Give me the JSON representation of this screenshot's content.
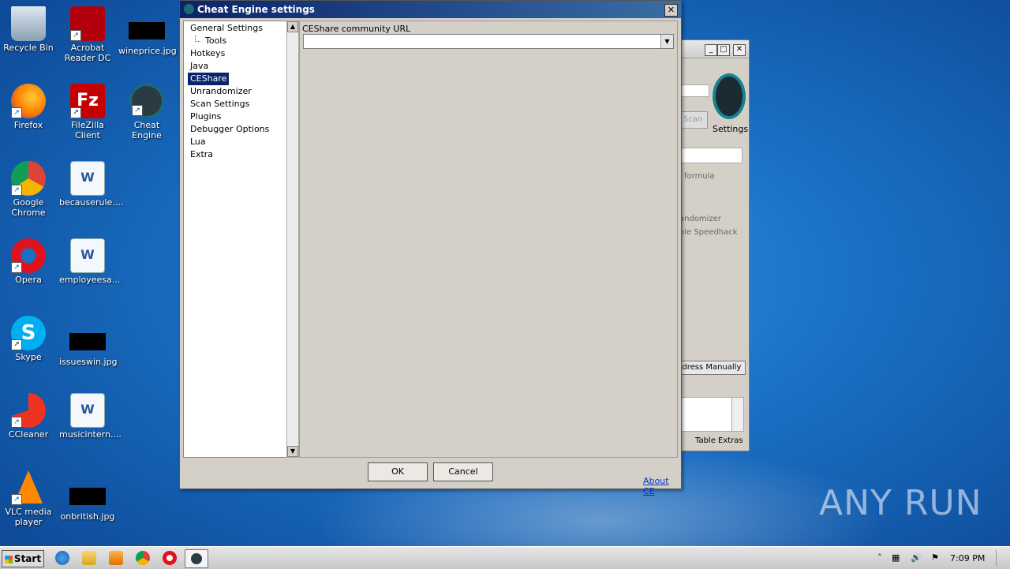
{
  "desktop": {
    "icons": [
      {
        "label": "Recycle Bin"
      },
      {
        "label": "Acrobat Reader DC"
      },
      {
        "label": "wineprice.jpg"
      },
      {
        "label": "Firefox"
      },
      {
        "label": "FileZilla Client"
      },
      {
        "label": "Cheat Engine"
      },
      {
        "label": "Google Chrome"
      },
      {
        "label": "becauserule...."
      },
      {
        "label": "Opera"
      },
      {
        "label": "employeesa..."
      },
      {
        "label": "Skype"
      },
      {
        "label": "issueswin.jpg"
      },
      {
        "label": "CCleaner"
      },
      {
        "label": "musicintern...."
      },
      {
        "label": "VLC media player"
      },
      {
        "label": "onbritish.jpg"
      }
    ]
  },
  "background_window": {
    "settings_label": "Settings",
    "scan_label": "Scan",
    "formula_label": "formula",
    "randomizer_label": "andomizer",
    "speedhack_label": "ble Speedhack",
    "add_address_label": "ddress Manually",
    "table_extras_label": "Table Extras"
  },
  "dialog": {
    "title": "Cheat Engine settings",
    "tree": [
      "General Settings",
      "Tools",
      "Hotkeys",
      "Java",
      "CEShare",
      "Unrandomizer",
      "Scan Settings",
      "Plugins",
      "Debugger Options",
      "Lua",
      "Extra"
    ],
    "selected": "CEShare",
    "url_label": "CEShare community URL",
    "url_value": "",
    "ok_label": "OK",
    "cancel_label": "Cancel",
    "about_label": "About CE"
  },
  "taskbar": {
    "start_label": "Start",
    "clock": "7:09 PM"
  },
  "watermark": "ANY RUN"
}
